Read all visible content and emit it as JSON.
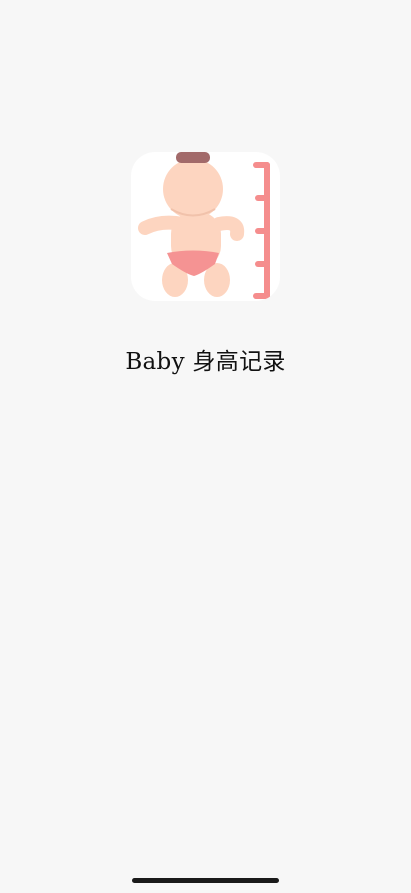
{
  "splash": {
    "app_name": "Baby 身高记录",
    "icon": "baby-height-ruler-icon",
    "colors": {
      "background": "#f7f7f7",
      "skin": "#fdd5c0",
      "hair": "#a26a6a",
      "diaper": "#f59393",
      "ruler": "#f58d8d"
    }
  }
}
